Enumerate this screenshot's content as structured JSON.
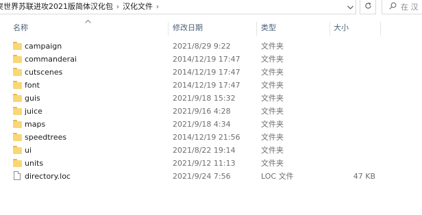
{
  "breadcrumb": {
    "items": [
      "突世界苏联进攻2021版简体汉化包",
      "汉化文件"
    ],
    "separator": "›"
  },
  "toolbar": {
    "dropdown_icon": "chevron-down-icon",
    "refresh_icon": "refresh-icon"
  },
  "search": {
    "icon": "search-icon",
    "placeholder": "在 汉"
  },
  "columns": {
    "name": "名称",
    "date": "修改日期",
    "type": "类型",
    "size": "大小"
  },
  "files": [
    {
      "name": "campaign",
      "date": "2021/8/29 9:22",
      "type": "文件夹",
      "size": "",
      "icon": "folder-icon"
    },
    {
      "name": "commanderai",
      "date": "2014/12/19 17:47",
      "type": "文件夹",
      "size": "",
      "icon": "folder-icon"
    },
    {
      "name": "cutscenes",
      "date": "2014/12/19 17:47",
      "type": "文件夹",
      "size": "",
      "icon": "folder-icon"
    },
    {
      "name": "font",
      "date": "2014/12/19 17:47",
      "type": "文件夹",
      "size": "",
      "icon": "folder-icon"
    },
    {
      "name": "guis",
      "date": "2021/9/18 15:32",
      "type": "文件夹",
      "size": "",
      "icon": "folder-icon"
    },
    {
      "name": "juice",
      "date": "2021/9/16 4:28",
      "type": "文件夹",
      "size": "",
      "icon": "folder-icon"
    },
    {
      "name": "maps",
      "date": "2021/9/18 4:34",
      "type": "文件夹",
      "size": "",
      "icon": "folder-icon"
    },
    {
      "name": "speedtrees",
      "date": "2014/12/19 21:56",
      "type": "文件夹",
      "size": "",
      "icon": "folder-icon"
    },
    {
      "name": "ui",
      "date": "2021/8/22 19:14",
      "type": "文件夹",
      "size": "",
      "icon": "folder-icon"
    },
    {
      "name": "units",
      "date": "2021/9/12 11:13",
      "type": "文件夹",
      "size": "",
      "icon": "folder-icon"
    },
    {
      "name": "directory.loc",
      "date": "2021/9/24 7:56",
      "type": "LOC 文件",
      "size": "47 KB",
      "icon": "file-icon"
    }
  ]
}
